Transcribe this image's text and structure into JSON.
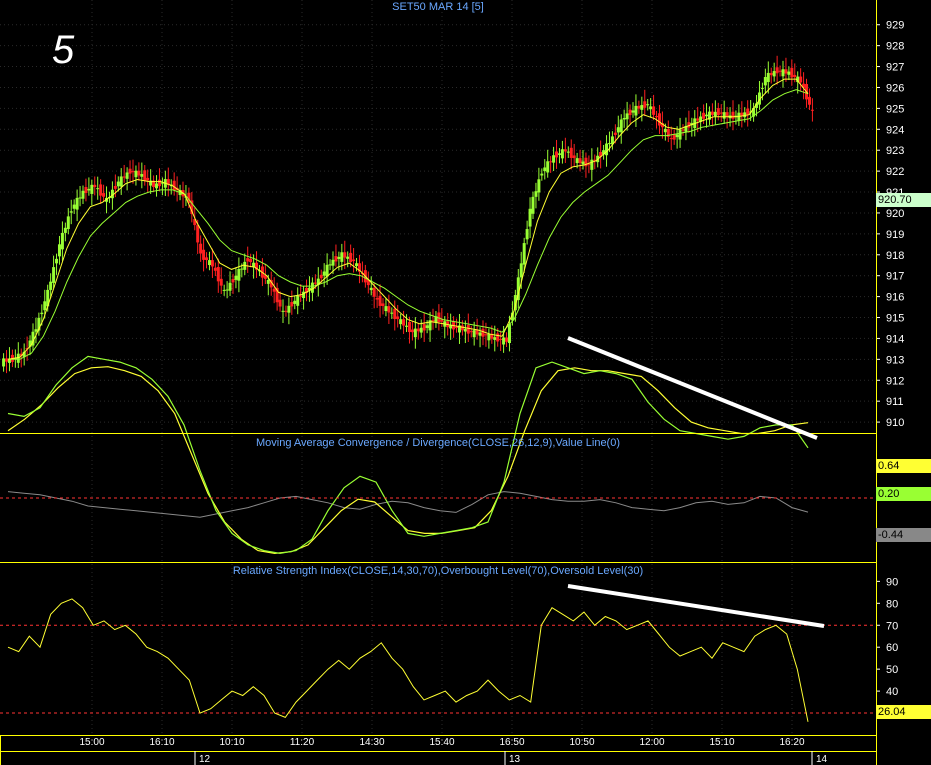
{
  "chart_label": "5",
  "title": "SET50 MAR 14   [5]",
  "x_axis": {
    "time_labels": [
      "15:00",
      "16:10",
      "10:10",
      "11:20",
      "14:30",
      "15:40",
      "16:50",
      "10:50",
      "12:00",
      "15:10",
      "16:20"
    ],
    "day_labels": [
      "12",
      "13",
      "14"
    ]
  },
  "colors": {
    "background": "#000000",
    "grid": "#2a2a2a",
    "candle_up": "#99ff33",
    "candle_down": "#ff2020",
    "ma_fast": "#ffff33",
    "ma_slow": "#99ff33",
    "panel_border": "#ffff00",
    "axis_text": "#ffffff",
    "title_text": "#6aa8ff",
    "trendline": "#ffffff",
    "level_line": "#ff3333"
  },
  "chart_data": [
    {
      "type": "candlestick",
      "title": "SET50 MAR 14   [5]",
      "y_ticks": [
        910,
        911,
        912,
        913,
        914,
        915,
        916,
        917,
        918,
        919,
        920,
        921,
        922,
        923,
        924,
        925,
        926,
        927,
        928,
        929
      ],
      "ylim": [
        909.0,
        929.8
      ],
      "last_price": "920.70",
      "close_series": [
        913.0,
        913.3,
        914.5,
        916.2,
        918.5,
        920.2,
        921.0,
        921.3,
        920.6,
        921.5,
        922.0,
        921.8,
        921.3,
        921.5,
        921.1,
        920.6,
        918.0,
        917.5,
        916.2,
        917.0,
        917.8,
        917.2,
        916.5,
        915.2,
        915.8,
        916.3,
        916.8,
        917.6,
        918.0,
        917.7,
        916.8,
        915.8,
        915.3,
        914.8,
        914.3,
        914.5,
        915.0,
        914.6,
        914.5,
        914.3,
        914.2,
        914.0,
        913.9,
        916.8,
        920.2,
        922.0,
        922.7,
        923.0,
        922.5,
        922.3,
        922.8,
        923.6,
        924.6,
        925.0,
        925.2,
        924.3,
        923.5,
        924.0,
        924.4,
        924.7,
        924.8,
        924.6,
        924.7,
        924.9,
        926.5,
        926.8,
        926.7,
        926.3,
        924.8
      ],
      "ma_fast_series": [
        913.0,
        913.1,
        913.7,
        914.9,
        916.6,
        918.3,
        919.5,
        920.3,
        920.5,
        920.9,
        921.4,
        921.6,
        921.5,
        921.5,
        921.3,
        920.9,
        919.6,
        918.6,
        917.6,
        917.3,
        917.5,
        917.4,
        917.0,
        916.2,
        916.0,
        916.1,
        916.4,
        916.9,
        917.4,
        917.6,
        917.2,
        916.6,
        916.0,
        915.4,
        914.9,
        914.7,
        914.8,
        914.7,
        914.6,
        914.5,
        914.4,
        914.2,
        914.1,
        915.3,
        917.5,
        919.6,
        921.0,
        921.9,
        922.2,
        922.3,
        922.5,
        923.0,
        923.7,
        924.3,
        924.7,
        924.5,
        924.1,
        924.0,
        924.2,
        924.4,
        924.6,
        924.6,
        924.6,
        924.7,
        925.5,
        926.1,
        926.4,
        926.4,
        925.7
      ],
      "ma_slow_series": [
        913.0,
        913.0,
        913.3,
        914.1,
        915.3,
        916.7,
        917.9,
        918.9,
        919.5,
        920.0,
        920.5,
        920.8,
        921.0,
        921.1,
        921.1,
        920.9,
        920.2,
        919.5,
        918.7,
        918.2,
        918.0,
        917.8,
        917.5,
        917.0,
        916.7,
        916.5,
        916.5,
        916.7,
        917.0,
        917.1,
        917.0,
        916.7,
        916.4,
        916.0,
        915.6,
        915.3,
        915.1,
        914.9,
        914.8,
        914.7,
        914.6,
        914.5,
        914.3,
        914.9,
        916.1,
        917.5,
        918.8,
        919.8,
        920.5,
        921.0,
        921.4,
        921.8,
        922.4,
        923.0,
        923.5,
        923.7,
        923.7,
        923.8,
        923.9,
        924.1,
        924.2,
        924.3,
        924.4,
        924.5,
        924.9,
        925.4,
        925.7,
        925.9,
        925.7
      ]
    },
    {
      "type": "line",
      "title": "Moving Average Convergence / Divergence(CLOSE,26,12,9),Value Line(0)",
      "value_tags": [
        "0.64",
        "0.20",
        "-0.44"
      ],
      "macd_series": [
        0.8,
        0.75,
        0.9,
        1.3,
        1.6,
        1.8,
        1.75,
        1.7,
        1.6,
        1.4,
        1.1,
        0.6,
        -0.2,
        -0.9,
        -1.3,
        -1.5,
        -1.6,
        -1.65,
        -1.6,
        -1.4,
        -0.9,
        -0.5,
        -0.3,
        -0.4,
        -0.9,
        -1.3,
        -1.35,
        -1.3,
        -1.25,
        -1.2,
        -1.1,
        -0.4,
        0.8,
        1.6,
        1.7,
        1.6,
        1.5,
        1.55,
        1.5,
        1.4,
        1.0,
        0.7,
        0.5,
        0.45,
        0.4,
        0.35,
        0.4,
        0.55,
        0.6,
        0.6,
        0.2
      ],
      "signal_series": [
        0.5,
        0.7,
        0.95,
        1.25,
        1.5,
        1.6,
        1.62,
        1.55,
        1.45,
        1.2,
        0.8,
        0.1,
        -0.6,
        -1.1,
        -1.4,
        -1.6,
        -1.65,
        -1.62,
        -1.5,
        -1.2,
        -0.9,
        -0.7,
        -0.75,
        -1.0,
        -1.25,
        -1.3,
        -1.3,
        -1.25,
        -1.2,
        -0.9,
        -0.3,
        0.5,
        1.2,
        1.55,
        1.6,
        1.55,
        1.55,
        1.5,
        1.45,
        1.2,
        0.9,
        0.65,
        0.55,
        0.5,
        0.45,
        0.45,
        0.5,
        0.6,
        0.64
      ],
      "histogram_series": [
        0.2,
        0.15,
        0.1,
        0.0,
        -0.1,
        -0.25,
        -0.3,
        -0.35,
        -0.4,
        -0.45,
        -0.5,
        -0.55,
        -0.6,
        -0.5,
        -0.4,
        -0.3,
        -0.15,
        0.0,
        0.05,
        -0.05,
        -0.15,
        -0.3,
        -0.35,
        -0.2,
        -0.1,
        -0.15,
        -0.3,
        -0.4,
        -0.45,
        -0.2,
        0.1,
        0.2,
        0.15,
        0.05,
        -0.05,
        -0.1,
        -0.1,
        -0.05,
        -0.15,
        -0.3,
        -0.35,
        -0.4,
        -0.3,
        -0.15,
        -0.1,
        -0.2,
        -0.15,
        0.05,
        0.0,
        -0.3,
        -0.44
      ],
      "ylim": [
        -1.8,
        2.0
      ]
    },
    {
      "type": "line",
      "title": "Relative Strength Index(CLOSE,14,30,70),Overbought Level(70),Oversold Level(30)",
      "y_ticks": [
        30,
        40,
        50,
        60,
        70,
        80,
        90
      ],
      "ylim": [
        20,
        97
      ],
      "levels": [
        70,
        30
      ],
      "last_value": "26.04",
      "rsi_series": [
        60,
        58,
        65,
        60,
        75,
        80,
        82,
        78,
        70,
        72,
        68,
        70,
        66,
        60,
        58,
        55,
        50,
        45,
        30,
        32,
        36,
        40,
        38,
        42,
        38,
        30,
        28,
        35,
        40,
        45,
        50,
        54,
        50,
        55,
        58,
        62,
        55,
        50,
        42,
        36,
        38,
        40,
        35,
        38,
        40,
        45,
        40,
        36,
        38,
        35,
        70,
        78,
        75,
        72,
        76,
        70,
        74,
        72,
        68,
        70,
        72,
        66,
        60,
        56,
        58,
        60,
        55,
        62,
        60,
        58,
        65,
        68,
        70,
        66,
        50,
        26
      ]
    }
  ]
}
